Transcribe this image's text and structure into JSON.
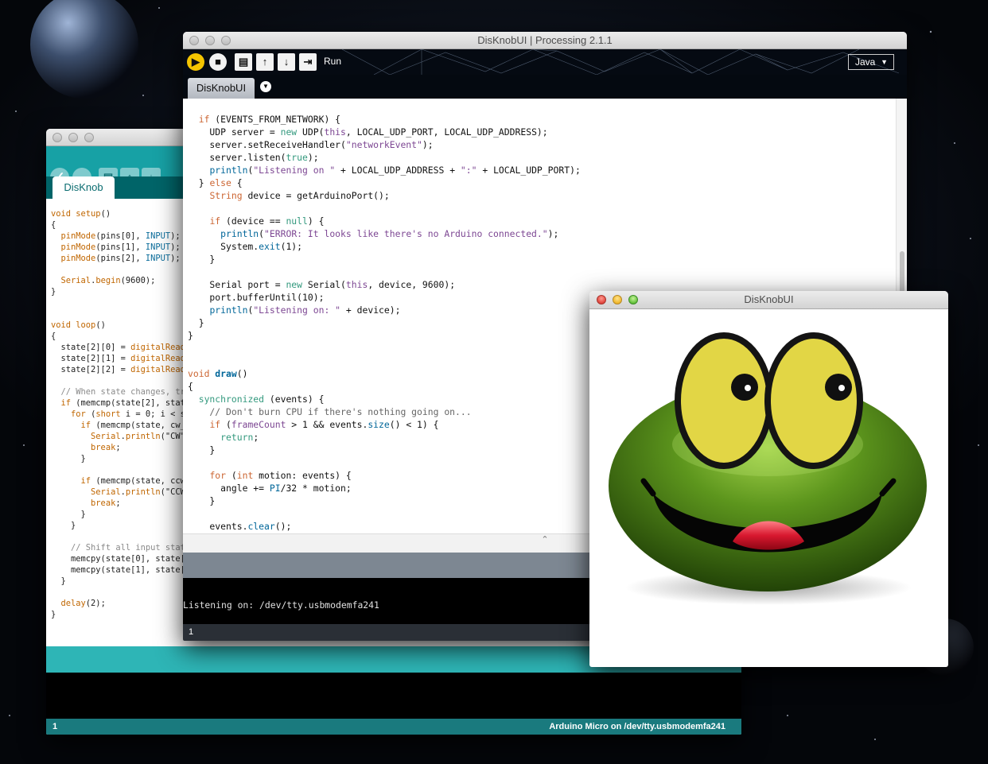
{
  "arduino_window": {
    "tab_label": "DisKnob",
    "toolbar": [
      "verify-button",
      "upload-button",
      "new-button",
      "open-button",
      "save-button"
    ],
    "code_lines": [
      [
        {
          "t": "void ",
          "c": "ak"
        },
        {
          "t": "setup",
          "c": "ak"
        },
        {
          "t": "()",
          "c": ""
        }
      ],
      [
        {
          "t": "{",
          "c": ""
        }
      ],
      [
        {
          "t": "  ",
          "c": ""
        },
        {
          "t": "pinMode",
          "c": "ak"
        },
        {
          "t": "(pins[0], ",
          "c": ""
        },
        {
          "t": "INPUT",
          "c": "ab"
        },
        {
          "t": ");",
          "c": ""
        }
      ],
      [
        {
          "t": "  ",
          "c": ""
        },
        {
          "t": "pinMode",
          "c": "ak"
        },
        {
          "t": "(pins[1], ",
          "c": ""
        },
        {
          "t": "INPUT",
          "c": "ab"
        },
        {
          "t": ");",
          "c": ""
        }
      ],
      [
        {
          "t": "  ",
          "c": ""
        },
        {
          "t": "pinMode",
          "c": "ak"
        },
        {
          "t": "(pins[2], ",
          "c": ""
        },
        {
          "t": "INPUT",
          "c": "ab"
        },
        {
          "t": ");",
          "c": ""
        }
      ],
      [
        {
          "t": "",
          "c": ""
        }
      ],
      [
        {
          "t": "  ",
          "c": ""
        },
        {
          "t": "Serial",
          "c": "ak"
        },
        {
          "t": ".",
          "c": ""
        },
        {
          "t": "begin",
          "c": "ak"
        },
        {
          "t": "(9600);",
          "c": ""
        }
      ],
      [
        {
          "t": "}",
          "c": ""
        }
      ],
      [
        {
          "t": "",
          "c": ""
        }
      ],
      [
        {
          "t": "",
          "c": ""
        }
      ],
      [
        {
          "t": "void ",
          "c": "ak"
        },
        {
          "t": "loop",
          "c": "ak"
        },
        {
          "t": "()",
          "c": ""
        }
      ],
      [
        {
          "t": "{",
          "c": ""
        }
      ],
      [
        {
          "t": "  state[2][0] = ",
          "c": ""
        },
        {
          "t": "digitalRead(",
          "c": "ak"
        }
      ],
      [
        {
          "t": "  state[2][1] = ",
          "c": ""
        },
        {
          "t": "digitalRead(",
          "c": "ak"
        }
      ],
      [
        {
          "t": "  state[2][2] = ",
          "c": ""
        },
        {
          "t": "digitalRead(",
          "c": "ak"
        }
      ],
      [
        {
          "t": "",
          "c": ""
        }
      ],
      [
        {
          "t": "  // When state changes, try",
          "c": "ac"
        }
      ],
      [
        {
          "t": "  ",
          "c": ""
        },
        {
          "t": "if",
          "c": "ak"
        },
        {
          "t": " (memcmp(state[2], state",
          "c": ""
        }
      ],
      [
        {
          "t": "    ",
          "c": ""
        },
        {
          "t": "for",
          "c": "ak"
        },
        {
          "t": " (",
          "c": ""
        },
        {
          "t": "short",
          "c": "ak"
        },
        {
          "t": " i = 0; i < si",
          "c": ""
        }
      ],
      [
        {
          "t": "      ",
          "c": ""
        },
        {
          "t": "if",
          "c": "ak"
        },
        {
          "t": " (memcmp(state, cw_s",
          "c": ""
        }
      ],
      [
        {
          "t": "        ",
          "c": ""
        },
        {
          "t": "Serial",
          "c": "ak"
        },
        {
          "t": ".",
          "c": ""
        },
        {
          "t": "println",
          "c": "ak"
        },
        {
          "t": "(\"CW\")",
          "c": ""
        }
      ],
      [
        {
          "t": "        ",
          "c": ""
        },
        {
          "t": "break",
          "c": "ak"
        },
        {
          "t": ";",
          "c": ""
        }
      ],
      [
        {
          "t": "      }",
          "c": ""
        }
      ],
      [
        {
          "t": "",
          "c": ""
        }
      ],
      [
        {
          "t": "      ",
          "c": ""
        },
        {
          "t": "if",
          "c": "ak"
        },
        {
          "t": " (memcmp(state, ccw_",
          "c": ""
        }
      ],
      [
        {
          "t": "        ",
          "c": ""
        },
        {
          "t": "Serial",
          "c": "ak"
        },
        {
          "t": ".",
          "c": ""
        },
        {
          "t": "println",
          "c": "ak"
        },
        {
          "t": "(\"CCW\"",
          "c": ""
        }
      ],
      [
        {
          "t": "        ",
          "c": ""
        },
        {
          "t": "break",
          "c": "ak"
        },
        {
          "t": ";",
          "c": ""
        }
      ],
      [
        {
          "t": "      }",
          "c": ""
        }
      ],
      [
        {
          "t": "    }",
          "c": ""
        }
      ],
      [
        {
          "t": "",
          "c": ""
        }
      ],
      [
        {
          "t": "    // Shift all input state",
          "c": "ac"
        }
      ],
      [
        {
          "t": "    memcpy(state[0], state[1",
          "c": ""
        }
      ],
      [
        {
          "t": "    memcpy(state[1], state[2",
          "c": ""
        }
      ],
      [
        {
          "t": "  }",
          "c": ""
        }
      ],
      [
        {
          "t": "",
          "c": ""
        }
      ],
      [
        {
          "t": "  ",
          "c": ""
        },
        {
          "t": "delay",
          "c": "ak"
        },
        {
          "t": "(2);",
          "c": ""
        }
      ],
      [
        {
          "t": "}",
          "c": ""
        }
      ]
    ],
    "status_line": "1",
    "status_board": "Arduino Micro on /dev/tty.usbmodemfa241"
  },
  "processing_window": {
    "title": "DisKnobUI | Processing 2.1.1",
    "run_label": "Run",
    "mode_label": "Java",
    "tab_label": "DisKnobUI",
    "code_lines": [
      [
        {
          "t": "  ",
          "c": ""
        },
        {
          "t": "if",
          "c": "pk"
        },
        {
          "t": " (EVENTS_FROM_NETWORK) {",
          "c": ""
        }
      ],
      [
        {
          "t": "    UDP server = ",
          "c": ""
        },
        {
          "t": "new",
          "c": "pl"
        },
        {
          "t": " UDP(",
          "c": ""
        },
        {
          "t": "this",
          "c": "ps"
        },
        {
          "t": ", LOCAL_UDP_PORT, LOCAL_UDP_ADDRESS);",
          "c": ""
        }
      ],
      [
        {
          "t": "    server.setReceiveHandler(",
          "c": ""
        },
        {
          "t": "\"networkEvent\"",
          "c": "ps"
        },
        {
          "t": ");",
          "c": ""
        }
      ],
      [
        {
          "t": "    server.listen(",
          "c": ""
        },
        {
          "t": "true",
          "c": "pl"
        },
        {
          "t": ");",
          "c": ""
        }
      ],
      [
        {
          "t": "    ",
          "c": ""
        },
        {
          "t": "println",
          "c": "pb"
        },
        {
          "t": "(",
          "c": ""
        },
        {
          "t": "\"Listening on \"",
          "c": "ps"
        },
        {
          "t": " + LOCAL_UDP_ADDRESS + ",
          "c": ""
        },
        {
          "t": "\":\"",
          "c": "ps"
        },
        {
          "t": " + LOCAL_UDP_PORT);",
          "c": ""
        }
      ],
      [
        {
          "t": "  } ",
          "c": ""
        },
        {
          "t": "else",
          "c": "pk"
        },
        {
          "t": " {",
          "c": ""
        }
      ],
      [
        {
          "t": "    ",
          "c": ""
        },
        {
          "t": "String",
          "c": "pk"
        },
        {
          "t": " device = getArduinoPort();",
          "c": ""
        }
      ],
      [
        {
          "t": "",
          "c": ""
        }
      ],
      [
        {
          "t": "    ",
          "c": ""
        },
        {
          "t": "if",
          "c": "pk"
        },
        {
          "t": " (device == ",
          "c": ""
        },
        {
          "t": "null",
          "c": "pl"
        },
        {
          "t": ") {",
          "c": ""
        }
      ],
      [
        {
          "t": "      ",
          "c": ""
        },
        {
          "t": "println",
          "c": "pb"
        },
        {
          "t": "(",
          "c": ""
        },
        {
          "t": "\"ERROR: It looks like there's no Arduino connected.\"",
          "c": "ps"
        },
        {
          "t": ");",
          "c": ""
        }
      ],
      [
        {
          "t": "      System.",
          "c": ""
        },
        {
          "t": "exit",
          "c": "pb"
        },
        {
          "t": "(1);",
          "c": ""
        }
      ],
      [
        {
          "t": "    }",
          "c": ""
        }
      ],
      [
        {
          "t": "",
          "c": ""
        }
      ],
      [
        {
          "t": "    Serial port = ",
          "c": ""
        },
        {
          "t": "new",
          "c": "pl"
        },
        {
          "t": " Serial(",
          "c": ""
        },
        {
          "t": "this",
          "c": "ps"
        },
        {
          "t": ", device, 9600);",
          "c": ""
        }
      ],
      [
        {
          "t": "    port.bufferUntil(10);",
          "c": ""
        }
      ],
      [
        {
          "t": "    ",
          "c": ""
        },
        {
          "t": "println",
          "c": "pb"
        },
        {
          "t": "(",
          "c": ""
        },
        {
          "t": "\"Listening on: \"",
          "c": "ps"
        },
        {
          "t": " + device);",
          "c": ""
        }
      ],
      [
        {
          "t": "  }",
          "c": ""
        }
      ],
      [
        {
          "t": "}",
          "c": ""
        }
      ],
      [
        {
          "t": "",
          "c": ""
        }
      ],
      [
        {
          "t": "",
          "c": ""
        }
      ],
      [
        {
          "t": "void",
          "c": "pk"
        },
        {
          "t": " ",
          "c": ""
        },
        {
          "t": "draw",
          "c": "pf"
        },
        {
          "t": "()",
          "c": ""
        }
      ],
      [
        {
          "t": "{",
          "c": ""
        }
      ],
      [
        {
          "t": "  ",
          "c": ""
        },
        {
          "t": "synchronized",
          "c": "pl"
        },
        {
          "t": " (events) {",
          "c": ""
        }
      ],
      [
        {
          "t": "    // Don't burn CPU if there's nothing going on...",
          "c": "pc"
        }
      ],
      [
        {
          "t": "    ",
          "c": ""
        },
        {
          "t": "if",
          "c": "pk"
        },
        {
          "t": " (",
          "c": ""
        },
        {
          "t": "frameCount",
          "c": "ps"
        },
        {
          "t": " > 1 && events.",
          "c": ""
        },
        {
          "t": "size",
          "c": "pb"
        },
        {
          "t": "() < 1) {",
          "c": ""
        }
      ],
      [
        {
          "t": "      ",
          "c": ""
        },
        {
          "t": "return",
          "c": "pl"
        },
        {
          "t": ";",
          "c": ""
        }
      ],
      [
        {
          "t": "    }",
          "c": ""
        }
      ],
      [
        {
          "t": "",
          "c": ""
        }
      ],
      [
        {
          "t": "    ",
          "c": ""
        },
        {
          "t": "for",
          "c": "pk"
        },
        {
          "t": " (",
          "c": ""
        },
        {
          "t": "int",
          "c": "pk"
        },
        {
          "t": " motion: events) {",
          "c": ""
        }
      ],
      [
        {
          "t": "      angle += ",
          "c": ""
        },
        {
          "t": "PI",
          "c": "pb"
        },
        {
          "t": "/32 * motion;",
          "c": ""
        }
      ],
      [
        {
          "t": "    }",
          "c": ""
        }
      ],
      [
        {
          "t": "",
          "c": ""
        }
      ],
      [
        {
          "t": "    events.",
          "c": ""
        },
        {
          "t": "clear",
          "c": "pb"
        },
        {
          "t": "();",
          "c": ""
        }
      ]
    ],
    "console_text": "Listening on: /dev/tty.usbmodemfa241",
    "status_line": "1"
  },
  "sketch_window": {
    "title": "DisKnobUI"
  },
  "colors": {
    "arduino_teal": "#17a1a5",
    "processing_toolbar": "#050a12",
    "frog_green": "#5a8f1c",
    "eye_yellow": "#e2d645",
    "mouth_red": "#c8102e"
  }
}
